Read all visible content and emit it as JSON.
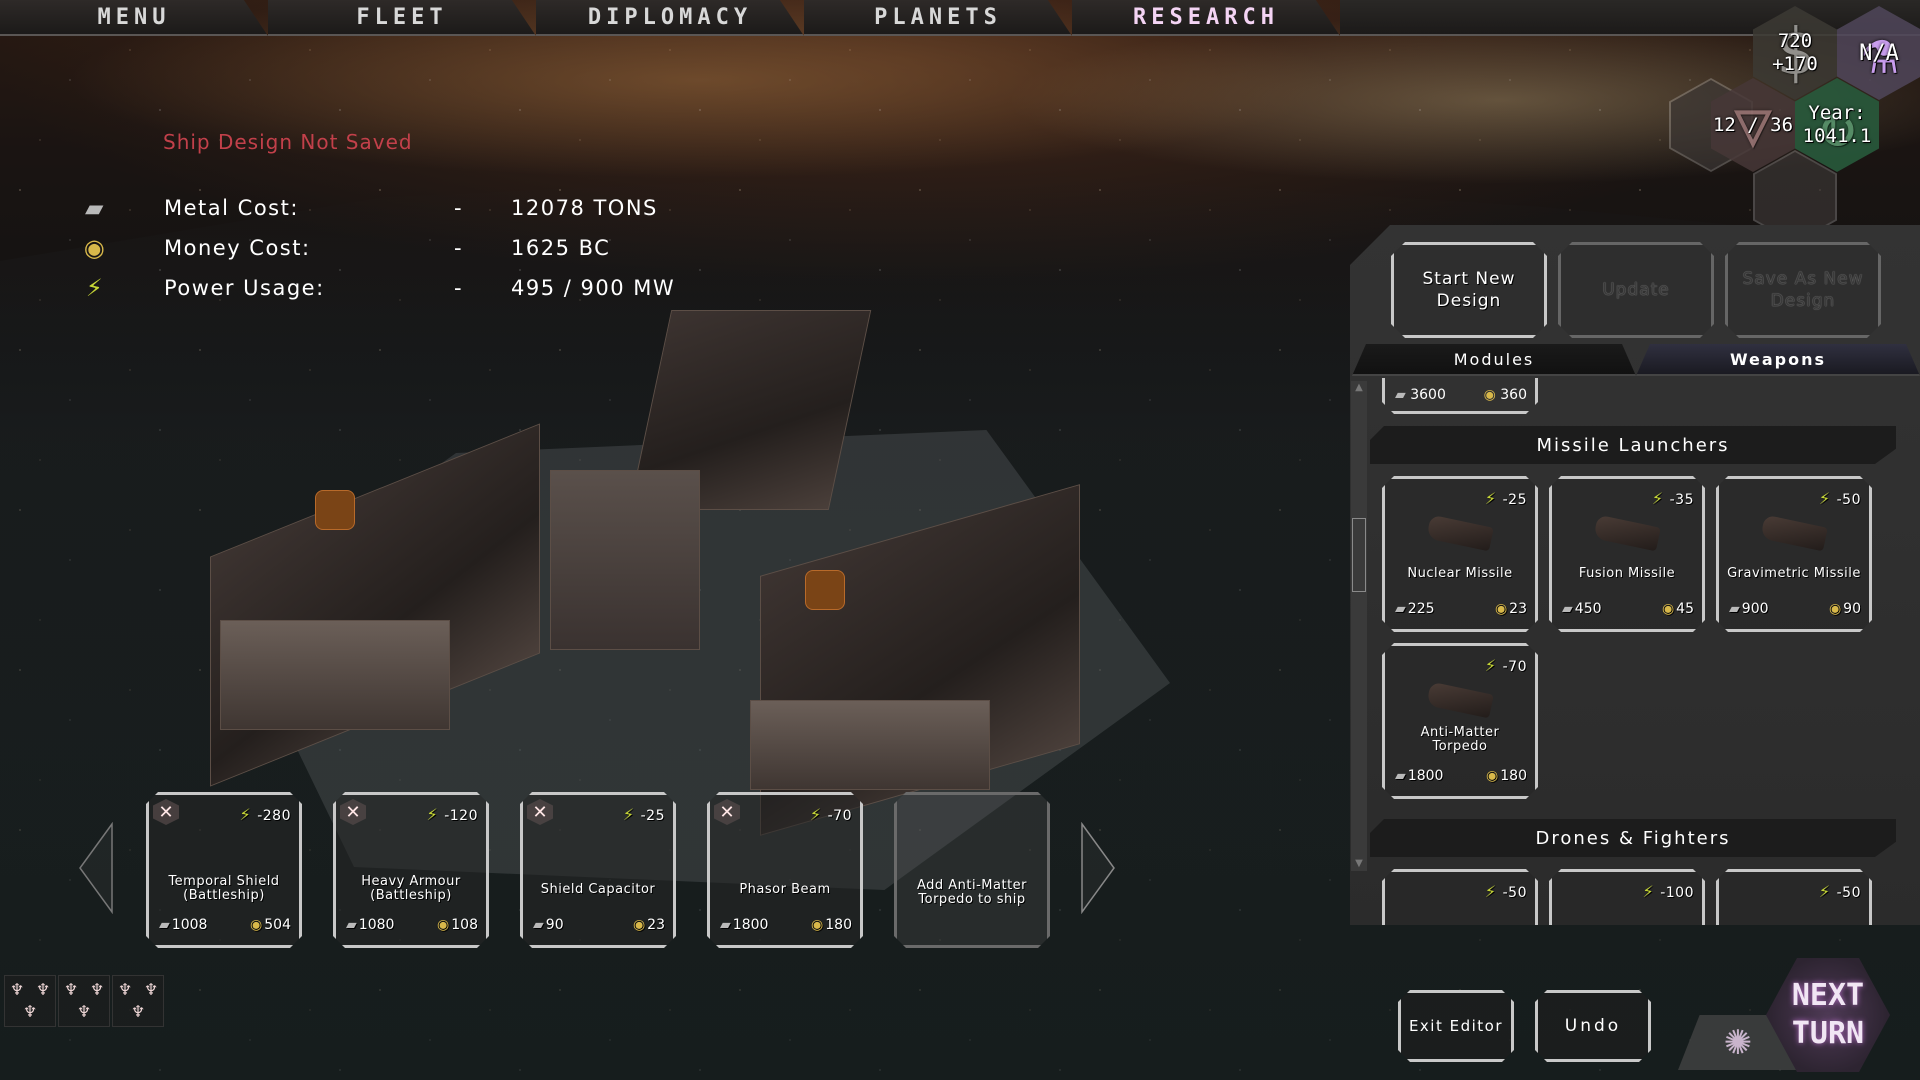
{
  "nav": {
    "tabs": [
      {
        "label": "MENU",
        "active": false
      },
      {
        "label": "FLEET",
        "active": false
      },
      {
        "label": "DIPLOMACY",
        "active": false
      },
      {
        "label": "PLANETS",
        "active": false
      },
      {
        "label": "RESEARCH",
        "active": true
      }
    ]
  },
  "hud": {
    "money": {
      "icon": "dollar-icon",
      "value": "720",
      "income": "+170"
    },
    "research": {
      "icon": "flask-icon",
      "value": "N/A",
      "color": "#d7a8ff"
    },
    "ships": {
      "icon": "fleet-emblem-icon",
      "value": "12 / 36"
    },
    "year": {
      "icon": "turn-cycle-icon",
      "label": "Year:",
      "value": "1041.1"
    }
  },
  "design": {
    "status": "Ship Design Not Saved",
    "status_color": "#c2404a",
    "stats": [
      {
        "icon": "metal-icon",
        "label": "Metal Cost:",
        "sep": "-",
        "value": "12078 TONS"
      },
      {
        "icon": "coins-icon",
        "label": "Money Cost:",
        "sep": "-",
        "value": "1625 BC"
      },
      {
        "icon": "power-icon",
        "label": "Power Usage:",
        "sep": "-",
        "value": "495 / 900 MW"
      }
    ]
  },
  "installed_modules": [
    {
      "name_line1": "Temporal Shield",
      "name_line2": "(Battleship)",
      "power": "-280",
      "metal": "1008",
      "money": "504"
    },
    {
      "name_line1": "Heavy Armour",
      "name_line2": "(Battleship)",
      "power": "-120",
      "metal": "1080",
      "money": "108"
    },
    {
      "name_line1": "Shield Capacitor",
      "name_line2": "",
      "power": "-25",
      "metal": "90",
      "money": "23"
    },
    {
      "name_line1": "Phasor Beam",
      "name_line2": "",
      "power": "-70",
      "metal": "1800",
      "money": "180"
    }
  ],
  "add_slot": {
    "line1": "Add Anti-Matter",
    "line2": "Torpedo to ship"
  },
  "side_panel": {
    "buttons": {
      "start_new_l1": "Start New",
      "start_new_l2": "Design",
      "update": "Update",
      "save_new_l1": "Save As New",
      "save_new_l2": "Design"
    },
    "tabs": [
      {
        "label": "Modules",
        "active": false
      },
      {
        "label": "Weapons",
        "active": true
      }
    ],
    "partial_card": {
      "metal": "3600",
      "money": "360"
    },
    "sections": [
      {
        "title": "Missile Launchers",
        "items": [
          {
            "name_line1": "Nuclear Missile",
            "name_line2": "",
            "power": "-25",
            "metal": "225",
            "money": "23"
          },
          {
            "name_line1": "Fusion Missile",
            "name_line2": "",
            "power": "-35",
            "metal": "450",
            "money": "45"
          },
          {
            "name_line1": "Gravimetric Missile",
            "name_line2": "",
            "power": "-50",
            "metal": "900",
            "money": "90"
          },
          {
            "name_line1": "Anti-Matter",
            "name_line2": "Torpedo",
            "power": "-70",
            "metal": "1800",
            "money": "180"
          }
        ]
      },
      {
        "title": "Drones & Fighters",
        "items": [
          {
            "power": "-50"
          },
          {
            "power": "-100"
          },
          {
            "power": "-50"
          }
        ]
      }
    ]
  },
  "bottom": {
    "exit_editor": "Exit Editor",
    "undo": "Undo",
    "next_turn_l1": "NEXT",
    "next_turn_l2": "TURN"
  },
  "glyphs": {
    "bolt": "⚡",
    "metal": "▰",
    "coin": "◉",
    "remove": "✕",
    "dollar": "$",
    "flask": "⚗",
    "galaxy": "✺",
    "up": "▲",
    "down": "▼",
    "fleet": "♆"
  }
}
